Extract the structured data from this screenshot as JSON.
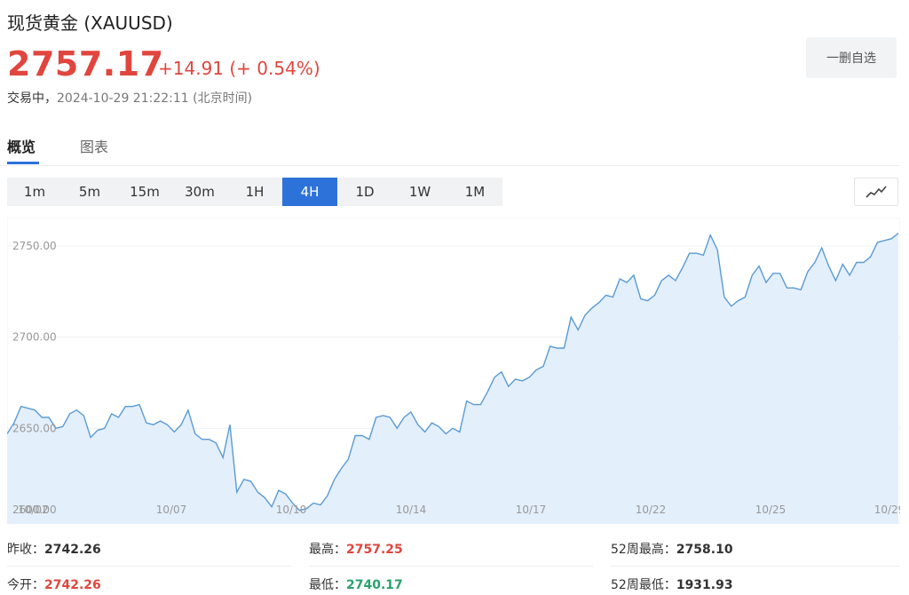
{
  "header": {
    "title": "现货黄金 (XAUUSD)",
    "price": "2757.17",
    "change": "+14.91 (+ 0.54%)",
    "status": "交易中，",
    "timestamp": "2024-10-29 21:22:11 (北京时间)",
    "watch_button": "一删自选"
  },
  "tabs": [
    {
      "label": "概览",
      "active": true
    },
    {
      "label": "图表",
      "active": false
    }
  ],
  "ranges": [
    {
      "label": "1m"
    },
    {
      "label": "5m"
    },
    {
      "label": "15m"
    },
    {
      "label": "30m"
    },
    {
      "label": "1H"
    },
    {
      "label": "4H",
      "active": true
    },
    {
      "label": "1D"
    },
    {
      "label": "1W"
    },
    {
      "label": "1M"
    }
  ],
  "chart_type_icon": "line-chart-icon",
  "colors": {
    "up": "#e0463e",
    "down": "#27a36a",
    "accent": "#2d72d9",
    "line": "#5b9bd5",
    "area": "#e3effb"
  },
  "chart_data": {
    "type": "area",
    "ylim": [
      2600,
      2760
    ],
    "yticks": [
      "2750.00",
      "2700.00",
      "2650.00",
      "2600.00"
    ],
    "xlabels": [
      "10/02",
      "10/07",
      "10/10",
      "10/14",
      "10/17",
      "10/22",
      "10/25",
      "10/29"
    ],
    "values": [
      2647,
      2653,
      2662,
      2661,
      2660,
      2656,
      2656,
      2650,
      2651,
      2658,
      2660,
      2657,
      2645,
      2649,
      2650,
      2658,
      2656,
      2662,
      2662,
      2663,
      2653,
      2652,
      2654,
      2652,
      2648,
      2652,
      2660,
      2647,
      2644,
      2644,
      2642,
      2634,
      2652,
      2615,
      2622,
      2621,
      2615,
      2612,
      2607,
      2616,
      2614,
      2609,
      2605,
      2606,
      2609,
      2608,
      2613,
      2622,
      2628,
      2633,
      2646,
      2646,
      2644,
      2656,
      2657,
      2656,
      2650,
      2656,
      2659,
      2652,
      2648,
      2653,
      2651,
      2647,
      2650,
      2648,
      2665,
      2663,
      2663,
      2670,
      2678,
      2681,
      2673,
      2677,
      2676,
      2678,
      2682,
      2684,
      2695,
      2694,
      2694,
      2711,
      2704,
      2712,
      2716,
      2719,
      2723,
      2722,
      2732,
      2730,
      2734,
      2721,
      2720,
      2723,
      2731,
      2734,
      2731,
      2738,
      2746,
      2746,
      2745,
      2756,
      2748,
      2722,
      2717,
      2720,
      2722,
      2734,
      2739,
      2730,
      2735,
      2735,
      2727,
      2727,
      2726,
      2736,
      2741,
      2749,
      2739,
      2731,
      2740,
      2734,
      2741,
      2741,
      2744,
      2752,
      2753,
      2754,
      2757
    ]
  },
  "stats": {
    "prev_close_label": "昨收：",
    "prev_close": "2742.26",
    "open_label": "今开：",
    "open": "2742.26",
    "high_label": "最高：",
    "high": "2757.25",
    "low_label": "最低：",
    "low": "2740.17",
    "high52_label": "52周最高：",
    "high52": "2758.10",
    "low52_label": "52周最低：",
    "low52": "1931.93"
  }
}
